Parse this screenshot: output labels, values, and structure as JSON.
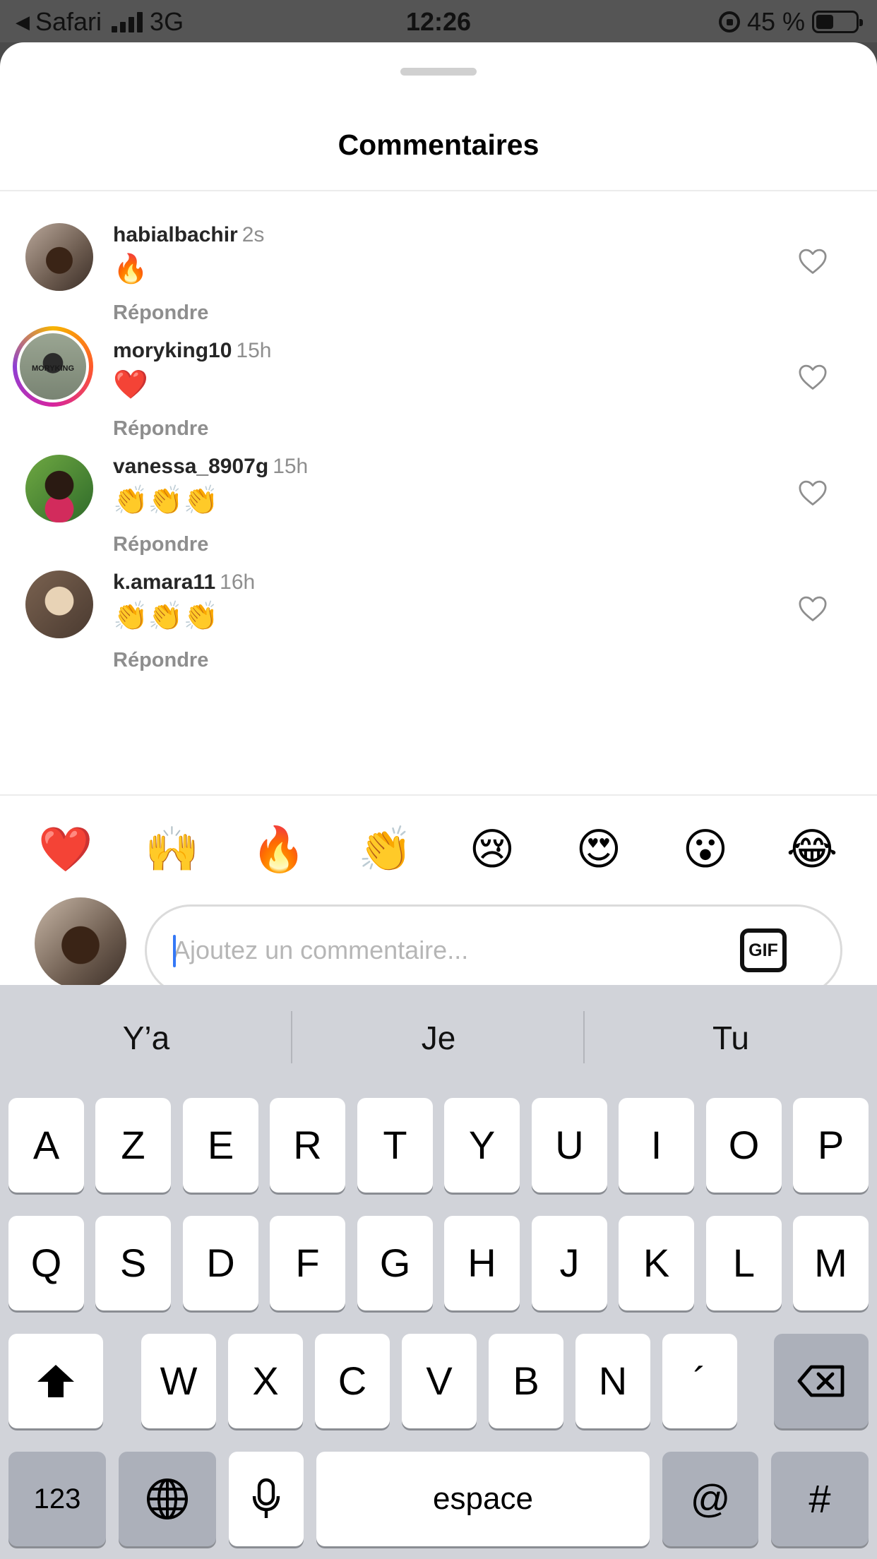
{
  "status_bar": {
    "back_app": "Safari",
    "network": "3G",
    "time": "12:26",
    "battery_text": "45 %",
    "battery_level": 0.45
  },
  "sheet": {
    "title": "Commentaires"
  },
  "comments": [
    {
      "username": "habialbachir",
      "time": "2s",
      "text": "🔥",
      "reply": "Répondre"
    },
    {
      "username": "moryking10",
      "time": "15h",
      "text": "❤️",
      "reply": "Répondre",
      "avatar_text": "MORYKING"
    },
    {
      "username": "vanessa_8907g",
      "time": "15h",
      "text": "👏👏👏",
      "reply": "Répondre"
    },
    {
      "username": "k.amara11",
      "time": "16h",
      "text": "👏👏👏",
      "reply": "Répondre"
    }
  ],
  "quick_emojis": [
    "❤️",
    "🙌",
    "🔥",
    "👏",
    "😢",
    "😍",
    "😮",
    "😂"
  ],
  "composer": {
    "placeholder": "Ajoutez un commentaire...",
    "gif_label": "GIF"
  },
  "keyboard": {
    "suggestions": [
      "Y’a",
      "Je",
      "Tu"
    ],
    "row1": [
      "A",
      "Z",
      "E",
      "R",
      "T",
      "Y",
      "U",
      "I",
      "O",
      "P"
    ],
    "row2": [
      "Q",
      "S",
      "D",
      "F",
      "G",
      "H",
      "J",
      "K",
      "L",
      "M"
    ],
    "row3": [
      "W",
      "X",
      "C",
      "V",
      "B",
      "N",
      "´"
    ],
    "numbers_key": "123",
    "space_key": "espace",
    "at_key": "@",
    "hash_key": "#"
  }
}
